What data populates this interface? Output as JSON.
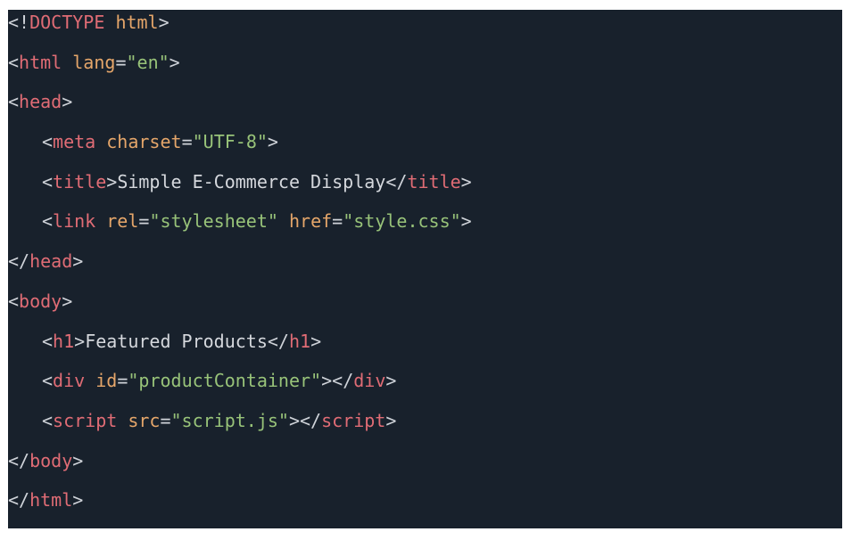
{
  "lines": [
    {
      "tokens": [
        [
          "p",
          "<!"
        ],
        [
          "d",
          "DOCTYPE"
        ],
        [
          "x",
          " "
        ],
        [
          "a",
          "html"
        ],
        [
          "p",
          ">"
        ]
      ]
    },
    {
      "tokens": [
        [
          "p",
          "<"
        ],
        [
          "t",
          "html"
        ],
        [
          "x",
          " "
        ],
        [
          "a",
          "lang"
        ],
        [
          "p",
          "="
        ],
        [
          "s",
          "\"en\""
        ],
        [
          "p",
          ">"
        ]
      ]
    },
    {
      "tokens": [
        [
          "p",
          "<"
        ],
        [
          "t",
          "head"
        ],
        [
          "p",
          ">"
        ]
      ]
    },
    {
      "indent": 1,
      "tokens": [
        [
          "p",
          "<"
        ],
        [
          "t",
          "meta"
        ],
        [
          "x",
          " "
        ],
        [
          "a",
          "charset"
        ],
        [
          "p",
          "="
        ],
        [
          "s",
          "\"UTF-8\""
        ],
        [
          "p",
          ">"
        ]
      ]
    },
    {
      "indent": 1,
      "tokens": [
        [
          "p",
          "<"
        ],
        [
          "t",
          "title"
        ],
        [
          "p",
          ">"
        ],
        [
          "x",
          "Simple E-Commerce Display"
        ],
        [
          "p",
          "</"
        ],
        [
          "t",
          "title"
        ],
        [
          "p",
          ">"
        ]
      ]
    },
    {
      "indent": 1,
      "tokens": [
        [
          "p",
          "<"
        ],
        [
          "t",
          "link"
        ],
        [
          "x",
          " "
        ],
        [
          "a",
          "rel"
        ],
        [
          "p",
          "="
        ],
        [
          "s",
          "\"stylesheet\""
        ],
        [
          "x",
          " "
        ],
        [
          "a",
          "href"
        ],
        [
          "p",
          "="
        ],
        [
          "s",
          "\"style.css\""
        ],
        [
          "p",
          ">"
        ]
      ]
    },
    {
      "tokens": [
        [
          "p",
          "</"
        ],
        [
          "t",
          "head"
        ],
        [
          "p",
          ">"
        ]
      ]
    },
    {
      "tokens": [
        [
          "p",
          "<"
        ],
        [
          "t",
          "body"
        ],
        [
          "p",
          ">"
        ]
      ]
    },
    {
      "indent": 1,
      "tokens": [
        [
          "p",
          "<"
        ],
        [
          "t",
          "h1"
        ],
        [
          "p",
          ">"
        ],
        [
          "x",
          "Featured Products"
        ],
        [
          "p",
          "</"
        ],
        [
          "t",
          "h1"
        ],
        [
          "p",
          ">"
        ]
      ]
    },
    {
      "indent": 1,
      "tokens": [
        [
          "p",
          "<"
        ],
        [
          "t",
          "div"
        ],
        [
          "x",
          " "
        ],
        [
          "a",
          "id"
        ],
        [
          "p",
          "="
        ],
        [
          "s",
          "\"productContainer\""
        ],
        [
          "p",
          "></"
        ],
        [
          "t",
          "div"
        ],
        [
          "p",
          ">"
        ]
      ]
    },
    {
      "indent": 1,
      "tokens": [
        [
          "p",
          "<"
        ],
        [
          "t",
          "script"
        ],
        [
          "x",
          " "
        ],
        [
          "a",
          "src"
        ],
        [
          "p",
          "="
        ],
        [
          "s",
          "\"script.js\""
        ],
        [
          "p",
          "></"
        ],
        [
          "t",
          "script"
        ],
        [
          "p",
          ">"
        ]
      ]
    },
    {
      "tokens": [
        [
          "p",
          "</"
        ],
        [
          "t",
          "body"
        ],
        [
          "p",
          ">"
        ]
      ]
    },
    {
      "tokens": [
        [
          "p",
          "</"
        ],
        [
          "t",
          "html"
        ],
        [
          "p",
          ">"
        ]
      ]
    }
  ],
  "colors": {
    "background": "#18212c",
    "tag": "#e06c75",
    "attribute": "#e5a66a",
    "string": "#98c379",
    "text": "#d5d8dd",
    "punctuation": "#cfd3d9"
  }
}
